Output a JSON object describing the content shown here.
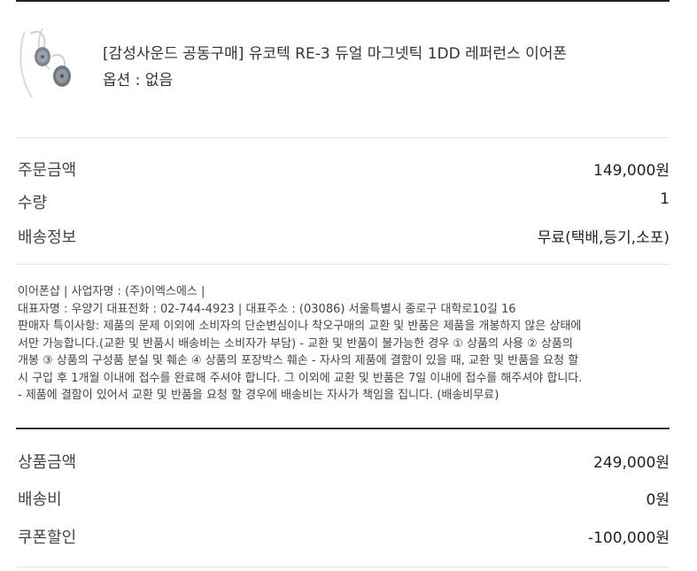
{
  "product": {
    "title": "[감성사운드 공동구매] 유코텍 RE-3 듀얼 마그넷틱 1DD 레퍼런스 이어폰",
    "option": "옵션 : 없음",
    "image_icon": "earphones-icon"
  },
  "order": {
    "rows": [
      {
        "label": "주문금액",
        "value": "149,000원"
      },
      {
        "label": "수량",
        "value": "1"
      },
      {
        "label": "배송정보",
        "value": "무료(택배,등기,소포)"
      }
    ]
  },
  "seller": {
    "line1": "이어폰샵 | 사업자명 : (주)이엑스에스 |",
    "line2": "대표자명 : 우양기 대표전화 : 02-744-4923 | 대표주소 : (03086) 서울특별시 종로구 대학로10길 16",
    "notice_lines": [
      "판매자 특이사항: 제품의 문제 이외에 소비자의 단순변심이나 착오구매의 교환 및 반품은 제품을 개봉하지 않은 상태에",
      "서만 가능합니다.(교환 및 반품시 배송비는 소비자가 부담) - 교환 및 반품이 불가능한 경우 ① 상품의 사용 ② 상품의",
      "개봉 ③ 상품의 구성품 분실 및 훼손 ④ 상품의 포장박스 훼손 - 자사의 제품에 결함이 있을 때, 교환 및 반품을 요청 할",
      "시 구입 후 1개월 이내에 접수를 완료해 주셔야 합니다. 그 이외에 교환 및 반품은 7일 이내에 접수를 해주셔야 합니다.",
      "- 제품에 결함이 있어서 교환 및 반품을 요청 할 경우에 배송비는 자사가 책임을 집니다. (배송비무료)"
    ]
  },
  "summary": {
    "rows": [
      {
        "label": "상품금액",
        "value": "249,000원"
      },
      {
        "label": "배송비",
        "value": "0원"
      },
      {
        "label": "쿠폰할인",
        "value": "-100,000원"
      }
    ]
  }
}
